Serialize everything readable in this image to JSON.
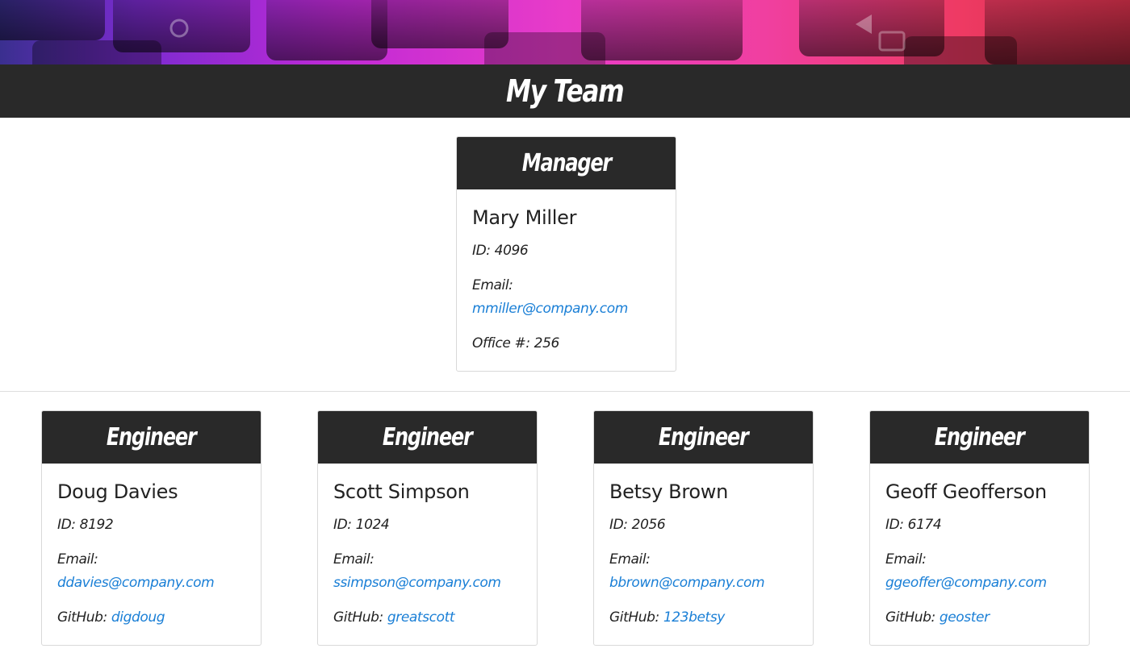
{
  "header": {
    "title": "My Team"
  },
  "manager": {
    "role": "Manager",
    "name": "Mary Miller",
    "id_label": "ID:",
    "id": "4096",
    "email_label": "Email:",
    "email": "mmiller@company.com",
    "extra_label": "Office #:",
    "extra": "256"
  },
  "engineers": [
    {
      "role": "Engineer",
      "name": "Doug Davies",
      "id_label": "ID:",
      "id": "8192",
      "email_label": "Email:",
      "email": "ddavies@company.com",
      "extra_label": "GitHub:",
      "extra": "digdoug"
    },
    {
      "role": "Engineer",
      "name": "Scott Simpson",
      "id_label": "ID:",
      "id": "1024",
      "email_label": "Email:",
      "email": "ssimpson@company.com",
      "extra_label": "GitHub:",
      "extra": "greatscott"
    },
    {
      "role": "Engineer",
      "name": "Betsy Brown",
      "id_label": "ID:",
      "id": "2056",
      "email_label": "Email:",
      "email": "bbrown@company.com",
      "extra_label": "GitHub:",
      "extra": "123betsy"
    },
    {
      "role": "Engineer",
      "name": "Geoff Geofferson",
      "id_label": "ID:",
      "id": "6174",
      "email_label": "Email:",
      "email": "ggeoffer@company.com",
      "extra_label": "GitHub:",
      "extra": "geoster"
    }
  ],
  "colors": {
    "header_bg": "#292929",
    "link": "#1a7fd6",
    "hero_accent_pink": "#e93cc8",
    "hero_accent_purple": "#7b2bd0"
  }
}
